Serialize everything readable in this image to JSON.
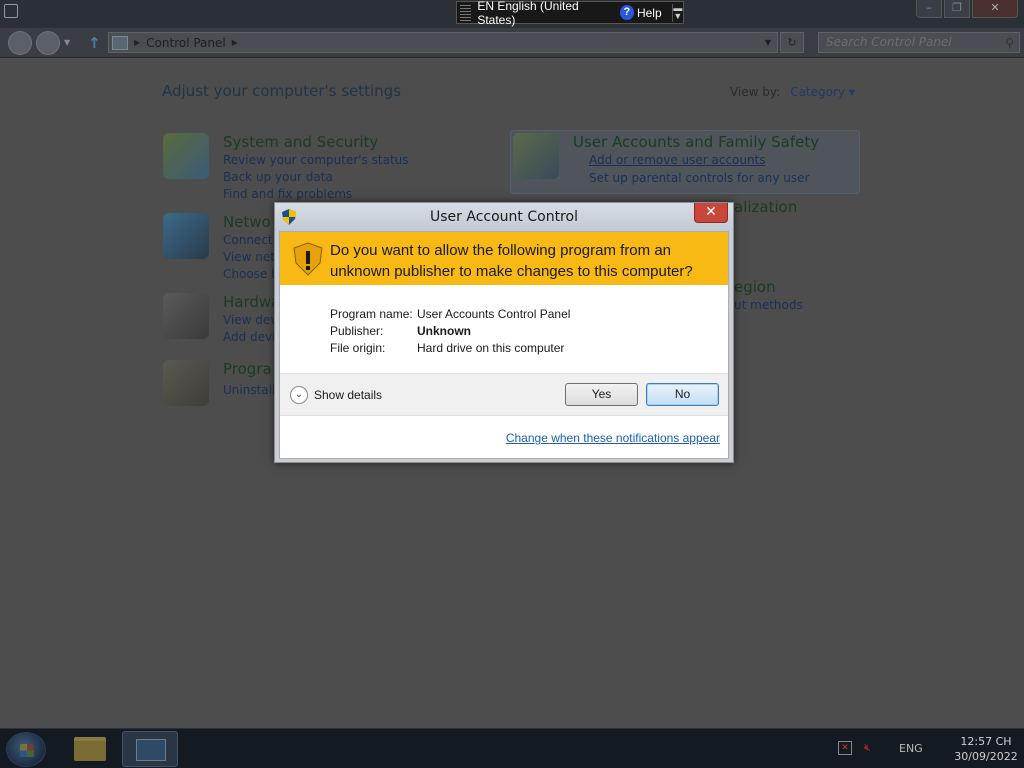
{
  "language_bar": {
    "lang": "EN English (United States)",
    "help": "Help"
  },
  "explorer": {
    "breadcrumb": [
      "Control Panel"
    ],
    "search_placeholder": "Search Control Panel",
    "heading": "Adjust your computer's settings",
    "view_by_label": "View by:",
    "view_by_value": "Category",
    "categories": [
      {
        "title": "System and Security",
        "links": [
          "Review your computer's status",
          "Back up your data",
          "Find and fix problems"
        ]
      },
      {
        "title": "Netwo",
        "links": [
          "Connect t",
          "View netw",
          "Choose h"
        ]
      },
      {
        "title": "Hardwa",
        "links": [
          "View dev",
          "Add devi"
        ]
      },
      {
        "title": "Progra",
        "links": [
          "Uninstall"
        ]
      },
      {
        "title": "User Accounts and Family Safety",
        "links": [
          "Add or remove user accounts",
          "Set up parental controls for any user"
        ]
      },
      {
        "title": "alization",
        "links": []
      },
      {
        "title": "egion",
        "links": [
          "ut methods"
        ]
      }
    ]
  },
  "uac": {
    "title": "User Account Control",
    "question": "Do you want to allow the following program from an unknown publisher to make changes to this computer?",
    "fields": [
      {
        "label": "Program name:",
        "value": "User Accounts Control Panel"
      },
      {
        "label": "Publisher:",
        "value": "Unknown"
      },
      {
        "label": "File origin:",
        "value": "Hard drive on this computer"
      }
    ],
    "show_details": "Show details",
    "yes": "Yes",
    "no": "No",
    "change_link": "Change when these notifications appear",
    "accent_color": "#f9b914"
  },
  "taskbar": {
    "tray_lang": "ENG",
    "time": "12:57 CH",
    "date": "30/09/2022"
  }
}
